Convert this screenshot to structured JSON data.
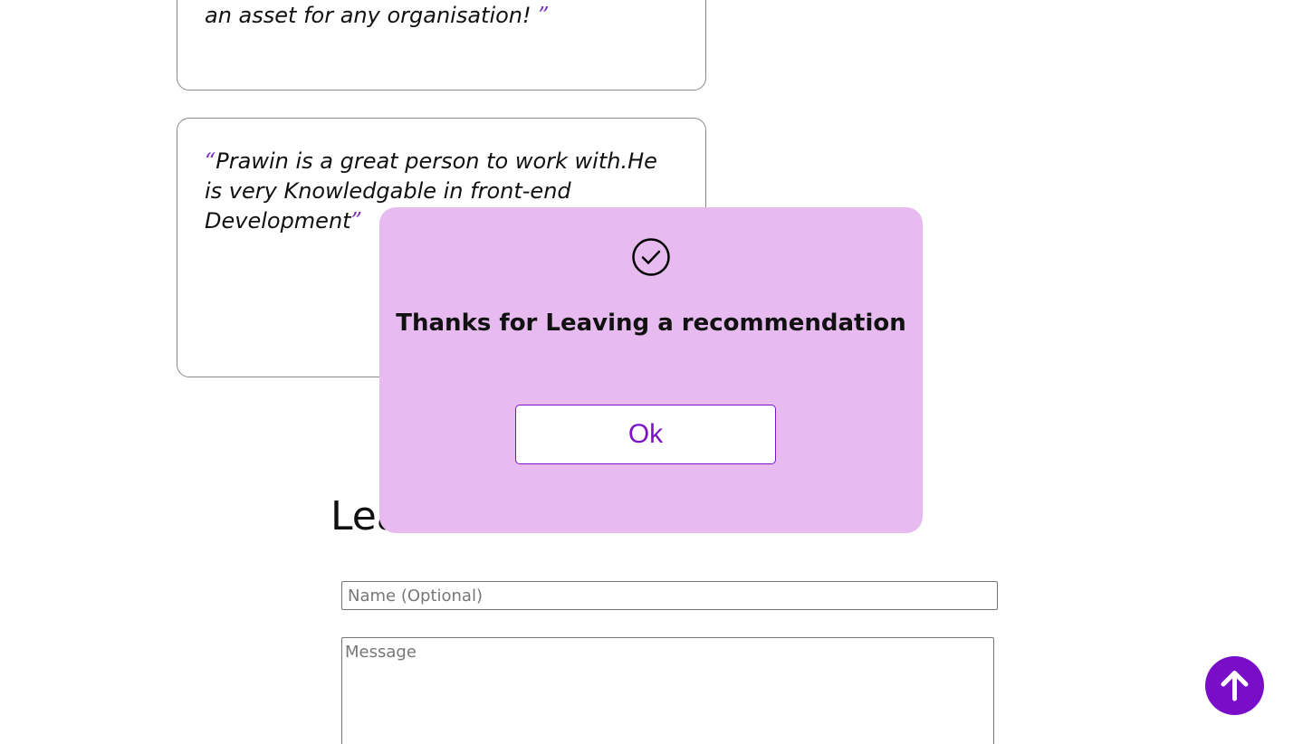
{
  "recommendations": [
    {
      "text": "an asset for any organisation! ",
      "open_quote": "",
      "close_quote": "”"
    },
    {
      "text": "Prawin is a great person to work with.He is very Knowledgable in front-end Development",
      "open_quote": "“",
      "close_quote": "”"
    }
  ],
  "form": {
    "heading": "Leave a Recommendation",
    "name_placeholder": "Name (Optional)",
    "message_placeholder": "Message"
  },
  "modal": {
    "icon": "check-circle-icon",
    "message": "Thanks for Leaving a recommendation",
    "ok_label": "Ok"
  },
  "scroll_top": {
    "icon": "arrow-up-icon"
  },
  "colors": {
    "accent": "#7a14c4",
    "modal_background": "#e7bbf0",
    "scroll_button": "#7a0ec8"
  }
}
